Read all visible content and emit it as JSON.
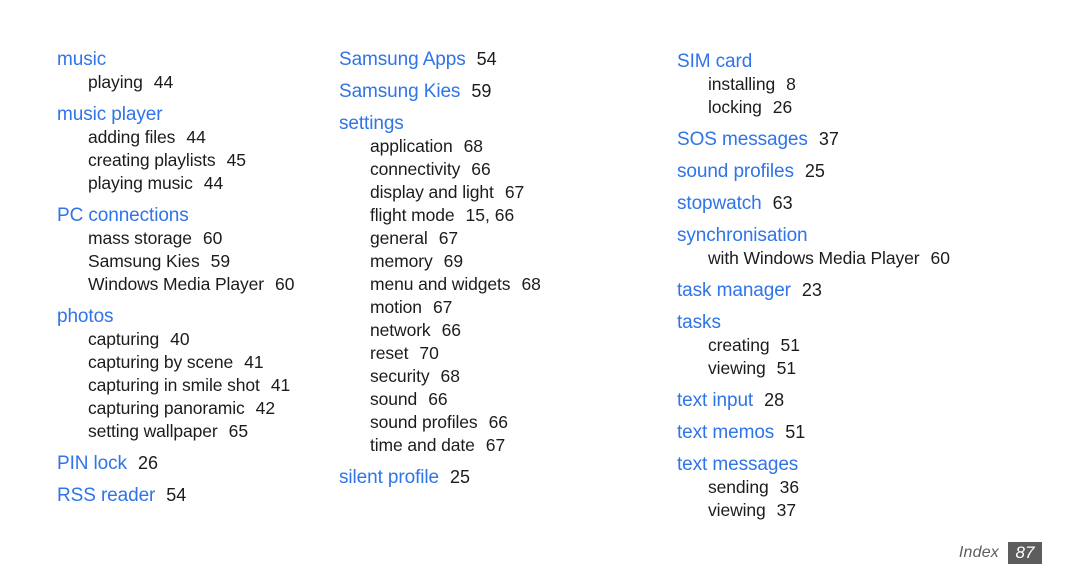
{
  "page": {
    "type": "index-page",
    "background_color": "#ffffff",
    "heading_color": "#2f74e8",
    "text_color": "#1c1c1c",
    "footer_box_color": "#5d5d5d"
  },
  "footer": {
    "label": "Index",
    "page_number": "87"
  },
  "columns": [
    {
      "id": "column-1",
      "groups": [
        {
          "heading": "music",
          "heading_page": "",
          "entries": [
            {
              "label": "playing",
              "page": "44"
            }
          ]
        },
        {
          "heading": "music player",
          "heading_page": "",
          "entries": [
            {
              "label": "adding files",
              "page": "44"
            },
            {
              "label": "creating playlists",
              "page": "45"
            },
            {
              "label": "playing music",
              "page": "44"
            }
          ]
        },
        {
          "heading": "PC connections",
          "heading_page": "",
          "entries": [
            {
              "label": "mass storage",
              "page": "60"
            },
            {
              "label": "Samsung Kies",
              "page": "59"
            },
            {
              "label": "Windows Media Player",
              "page": "60"
            }
          ]
        },
        {
          "heading": "photos",
          "heading_page": "",
          "entries": [
            {
              "label": "capturing",
              "page": "40"
            },
            {
              "label": "capturing by scene",
              "page": "41"
            },
            {
              "label": "capturing in smile shot",
              "page": "41"
            },
            {
              "label": "capturing panoramic",
              "page": "42"
            },
            {
              "label": "setting wallpaper",
              "page": "65"
            }
          ]
        },
        {
          "heading": "PIN lock",
          "heading_page": "26",
          "entries": []
        },
        {
          "heading": "RSS reader",
          "heading_page": "54",
          "entries": []
        }
      ]
    },
    {
      "id": "column-2",
      "groups": [
        {
          "heading": "Samsung Apps",
          "heading_page": "54",
          "entries": []
        },
        {
          "heading": "Samsung Kies",
          "heading_page": "59",
          "entries": []
        },
        {
          "heading": "settings",
          "heading_page": "",
          "entries": [
            {
              "label": "application",
              "page": "68"
            },
            {
              "label": "connectivity",
              "page": "66"
            },
            {
              "label": "display and light",
              "page": "67"
            },
            {
              "label": "flight mode",
              "page": "15, 66"
            },
            {
              "label": "general",
              "page": "67"
            },
            {
              "label": "memory",
              "page": "69"
            },
            {
              "label": "menu and widgets",
              "page": "68"
            },
            {
              "label": "motion",
              "page": "67"
            },
            {
              "label": "network",
              "page": "66"
            },
            {
              "label": "reset",
              "page": "70"
            },
            {
              "label": "security",
              "page": "68"
            },
            {
              "label": "sound",
              "page": "66"
            },
            {
              "label": "sound profiles",
              "page": "66"
            },
            {
              "label": "time and date",
              "page": "67"
            }
          ]
        },
        {
          "heading": "silent profile",
          "heading_page": "25",
          "entries": []
        }
      ]
    },
    {
      "id": "column-3",
      "groups": [
        {
          "heading": "SIM card",
          "heading_page": "",
          "entries": [
            {
              "label": "installing",
              "page": "8"
            },
            {
              "label": "locking",
              "page": "26"
            }
          ]
        },
        {
          "heading": "SOS messages",
          "heading_page": "37",
          "entries": []
        },
        {
          "heading": "sound profiles",
          "heading_page": "25",
          "entries": []
        },
        {
          "heading": "stopwatch",
          "heading_page": "63",
          "entries": []
        },
        {
          "heading": "synchronisation",
          "heading_page": "",
          "entries": [
            {
              "label": "with Windows Media Player",
              "page": "60"
            }
          ]
        },
        {
          "heading": "task manager",
          "heading_page": "23",
          "entries": []
        },
        {
          "heading": "tasks",
          "heading_page": "",
          "entries": [
            {
              "label": "creating",
              "page": "51"
            },
            {
              "label": "viewing",
              "page": "51"
            }
          ]
        },
        {
          "heading": "text input",
          "heading_page": "28",
          "entries": []
        },
        {
          "heading": "text memos",
          "heading_page": "51",
          "entries": []
        },
        {
          "heading": "text messages",
          "heading_page": "",
          "entries": [
            {
              "label": "sending",
              "page": "36"
            },
            {
              "label": "viewing",
              "page": "37"
            }
          ]
        }
      ]
    }
  ]
}
